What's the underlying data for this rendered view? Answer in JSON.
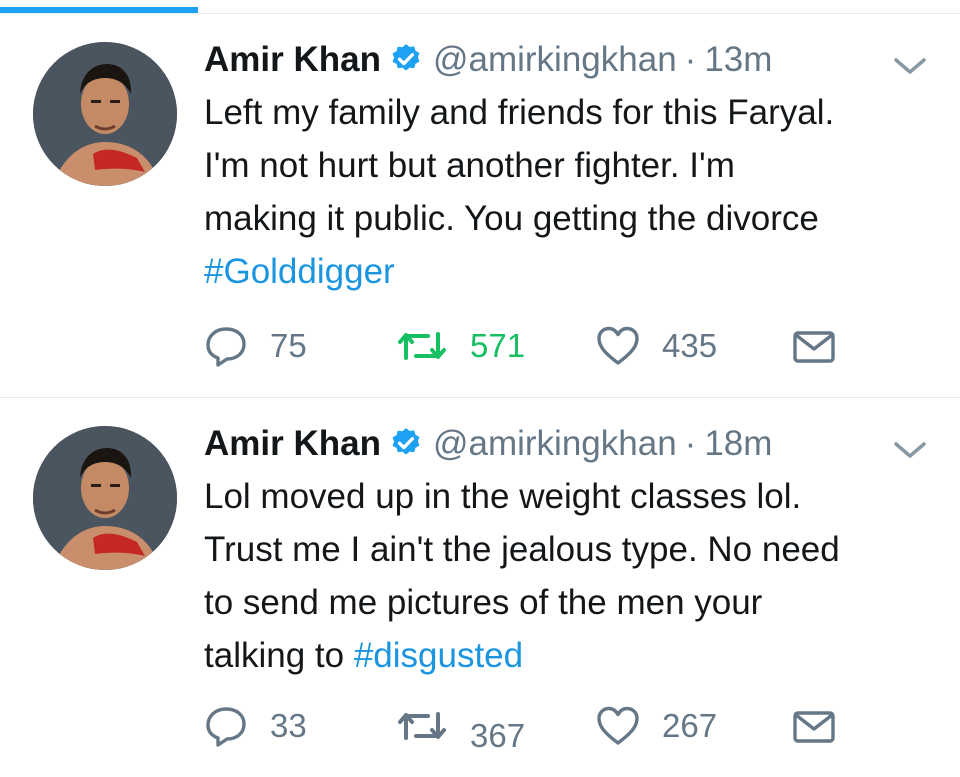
{
  "tweets": [
    {
      "name": "Amir Khan",
      "handle": "@amirkingkhan",
      "separator": "·",
      "time": "13m",
      "text": "Left my family and friends for this Faryal.\nI'm not hurt but another fighter. I'm\nmaking it public. You getting the divorce\n",
      "hashtag": "#Golddigger",
      "replies": "75",
      "retweets": "571",
      "likes": "435",
      "retweeted": true
    },
    {
      "name": "Amir Khan",
      "handle": "@amirkingkhan",
      "separator": "·",
      "time": "18m",
      "text": "Lol moved up in the weight classes lol.\nTrust me I ain't the jealous type. No need\nto send me pictures of the men your\ntalking to ",
      "hashtag": "#disgusted",
      "replies": "33",
      "retweets": "367",
      "likes": "267",
      "retweeted": false
    }
  ],
  "colors": {
    "accent": "#1da1f2",
    "link": "#1b95e0",
    "retweet_active": "#17bf63",
    "muted": "#657786",
    "text": "#14171a"
  },
  "icons": [
    "verified-badge-icon",
    "caret-down-icon",
    "reply-icon",
    "retweet-icon",
    "like-icon",
    "direct-message-icon"
  ]
}
